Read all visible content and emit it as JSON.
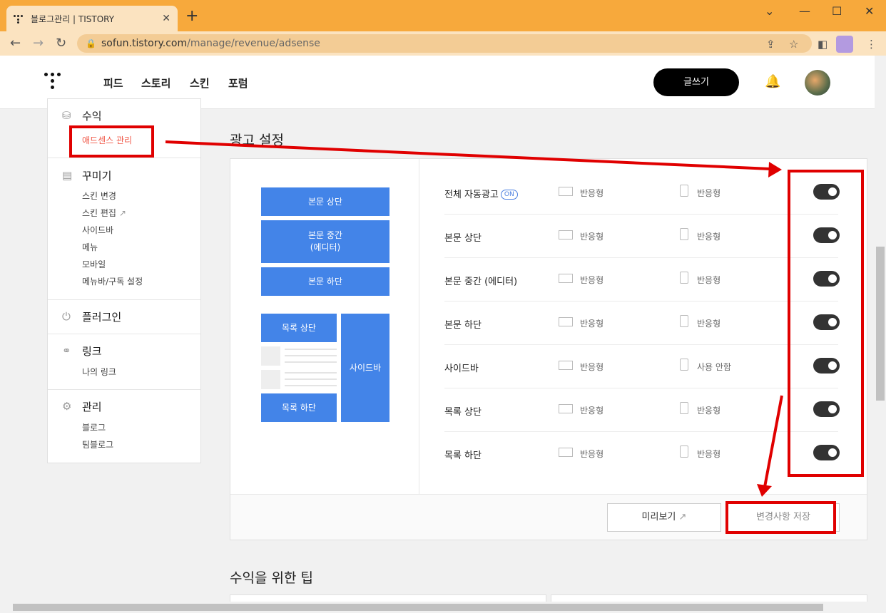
{
  "browser": {
    "tab_title": "블로그관리 | TISTORY",
    "url_host": "sofun.tistory.com",
    "url_path": "/manage/revenue/adsense"
  },
  "topnav": {
    "menu": [
      "피드",
      "스토리",
      "스킨",
      "포럼"
    ],
    "write_label": "글쓰기"
  },
  "sidebar": {
    "revenue": {
      "title": "수익",
      "items": [
        "애드센스 관리"
      ]
    },
    "decorate": {
      "title": "꾸미기",
      "items": [
        "스킨 변경",
        "스킨 편집",
        "사이드바",
        "메뉴",
        "모바일",
        "메뉴바/구독 설정"
      ]
    },
    "plugin": {
      "title": "플러그인"
    },
    "link": {
      "title": "링크",
      "items": [
        "나의 링크"
      ]
    },
    "manage": {
      "title": "관리",
      "items": [
        "블로그",
        "팀블로그"
      ]
    }
  },
  "main": {
    "section_title": "광고 설정",
    "preview_blocks": {
      "body_top": "본문 상단",
      "body_middle_1": "본문 중간",
      "body_middle_2": "(에디터)",
      "body_bottom": "본문 하단",
      "list_top": "목록 상단",
      "list_bottom": "목록 하단",
      "sidebar": "사이드바"
    },
    "on_badge": "ON",
    "rows": [
      {
        "label": "전체 자동광고",
        "pc": "반응형",
        "mobile": "반응형",
        "enabled": true
      },
      {
        "label": "본문 상단",
        "pc": "반응형",
        "mobile": "반응형",
        "enabled": true
      },
      {
        "label": "본문 중간 (에디터)",
        "pc": "반응형",
        "mobile": "반응형",
        "enabled": true
      },
      {
        "label": "본문 하단",
        "pc": "반응형",
        "mobile": "반응형",
        "enabled": true
      },
      {
        "label": "사이드바",
        "pc": "반응형",
        "mobile": "사용 안함",
        "enabled": true
      },
      {
        "label": "목록 상단",
        "pc": "반응형",
        "mobile": "반응형",
        "enabled": true
      },
      {
        "label": "목록 하단",
        "pc": "반응형",
        "mobile": "반응형",
        "enabled": true
      }
    ],
    "preview_button": "미리보기",
    "save_button": "변경사항 저장",
    "tips_title": "수익을 위한 팁"
  },
  "colors": {
    "accent_blue": "#4384e8",
    "annotation_red": "#e00000",
    "titlebar": "#f7a93c"
  },
  "icons": [
    "back-icon",
    "forward-icon",
    "reload-icon",
    "lock-icon",
    "share-icon",
    "star-icon",
    "sidepanel-icon",
    "menu-icon",
    "bell-icon"
  ]
}
